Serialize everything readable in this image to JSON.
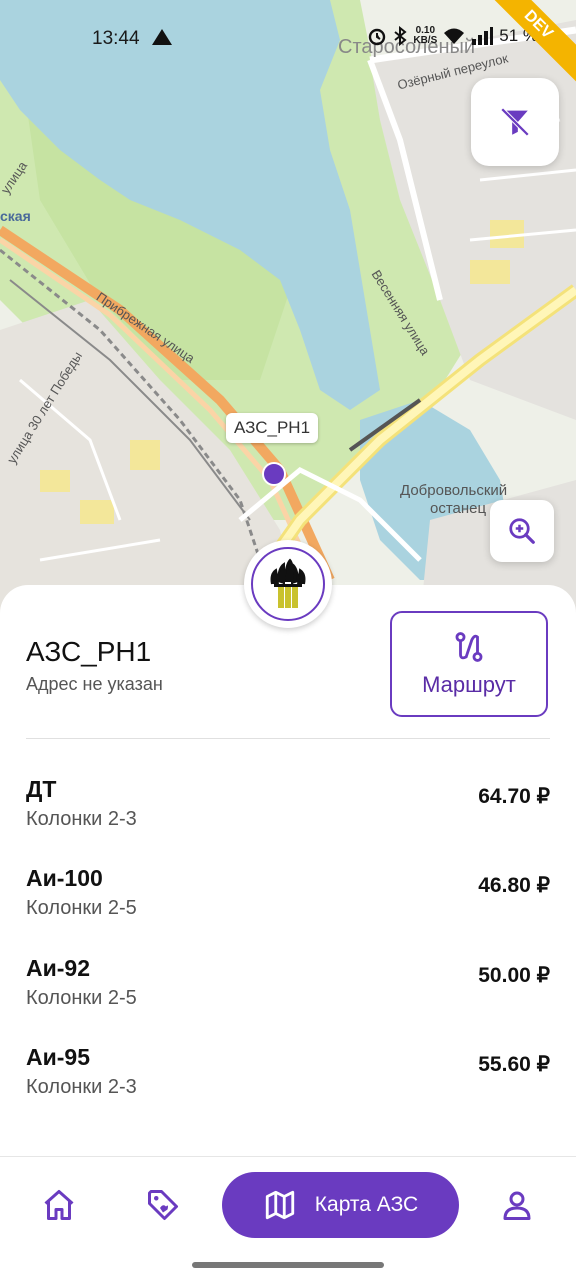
{
  "status_bar": {
    "time": "13:44",
    "net_speed_value": "0.10",
    "net_speed_unit": "KB/S",
    "battery": "51 %",
    "dev_ribbon": "DEV"
  },
  "map": {
    "labels": {
      "street_ozerny": "Озёрный переулок",
      "street_pribrezhnaya": "Прибрежная улица",
      "street_vesennyaya": "Весенняя улица",
      "street_30_let": "улица 30 лет Победы",
      "stop_dobrovolsky_1": "Добровольский",
      "stop_dobrovolsky_2": "останец",
      "district_top": "Старосоленый",
      "street_left": "ская",
      "street_left2": "улица"
    },
    "marker_label": "АЗС_РН1"
  },
  "station": {
    "name": "АЗС_РН1",
    "address": "Адрес не указан",
    "route_label": "Маршрут"
  },
  "fuels": [
    {
      "name": "ДТ",
      "columns": "Колонки 2-3",
      "price": "64.70 ₽"
    },
    {
      "name": "Аи-100",
      "columns": "Колонки 2-5",
      "price": "46.80 ₽"
    },
    {
      "name": "Аи-92",
      "columns": "Колонки 2-5",
      "price": "50.00 ₽"
    },
    {
      "name": "Аи-95",
      "columns": "Колонки 2-3",
      "price": "55.60 ₽"
    }
  ],
  "bottom_nav": {
    "active_label": "Карта АЗС",
    "items": [
      "home-icon",
      "tag-icon",
      "map-icon",
      "profile-icon"
    ]
  },
  "colors": {
    "accent": "#6a3bc0",
    "water": "#aad3df",
    "park": "#c8e6a8"
  }
}
